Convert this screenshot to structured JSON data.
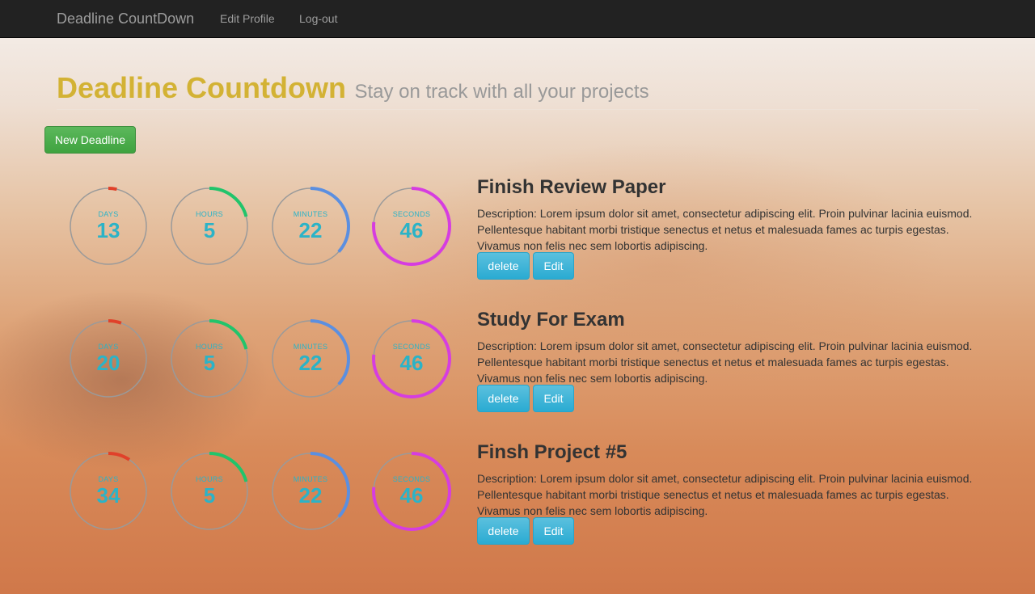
{
  "nav": {
    "brand": "Deadline CountDown",
    "edit_profile": "Edit Profile",
    "logout": "Log-out"
  },
  "header": {
    "title": "Deadline Countdown",
    "subtitle": "Stay on track with all your projects"
  },
  "new_button": "New Deadline",
  "labels": {
    "days": "DAYS",
    "hours": "HOURS",
    "minutes": "MINUTES",
    "seconds": "SECONDS"
  },
  "colors": {
    "days": "#e0412a",
    "hours": "#21c46b",
    "minutes": "#5b8fe0",
    "seconds": "#d63de0",
    "track": "#9a9a9a",
    "value_text": "#2bb3c7"
  },
  "deadlines": [
    {
      "title": "Finish Review Paper",
      "description": "Description: Lorem ipsum dolor sit amet, consectetur adipiscing elit. Proin pulvinar lacinia euismod. Pellentesque habitant morbi tristique senectus et netus et malesuada fames ac turpis egestas. Vivamus non felis nec sem lobortis adipiscing.",
      "days": "13",
      "hours": "5",
      "minutes": "22",
      "seconds": "46",
      "delete_label": "delete",
      "edit_label": "Edit"
    },
    {
      "title": "Study For Exam",
      "description": "Description: Lorem ipsum dolor sit amet, consectetur adipiscing elit. Proin pulvinar lacinia euismod. Pellentesque habitant morbi tristique senectus et netus et malesuada fames ac turpis egestas. Vivamus non felis nec sem lobortis adipiscing.",
      "days": "20",
      "hours": "5",
      "minutes": "22",
      "seconds": "46",
      "delete_label": "delete",
      "edit_label": "Edit"
    },
    {
      "title": "Finsh Project #5",
      "description": "Description: Lorem ipsum dolor sit amet, consectetur adipiscing elit. Proin pulvinar lacinia euismod. Pellentesque habitant morbi tristique senectus et netus et malesuada fames ac turpis egestas. Vivamus non felis nec sem lobortis adipiscing.",
      "days": "34",
      "hours": "5",
      "minutes": "22",
      "seconds": "46",
      "delete_label": "delete",
      "edit_label": "Edit"
    }
  ]
}
